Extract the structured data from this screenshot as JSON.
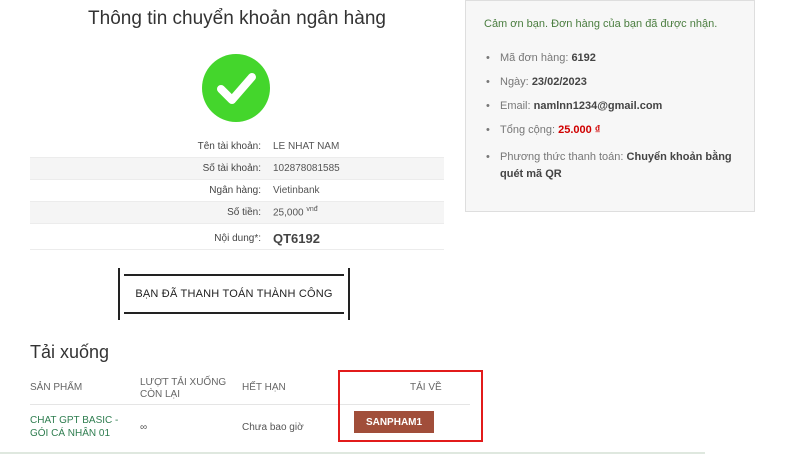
{
  "bank": {
    "title": "Thông tin chuyển khoản ngân hàng",
    "rows": [
      {
        "label": "Tên tài khoản:",
        "value": "LE NHAT NAM"
      },
      {
        "label": "Số tài khoản:",
        "value": "102878081585"
      },
      {
        "label": "Ngân hàng:",
        "value": "Vietinbank"
      },
      {
        "label": "Số tiền:",
        "value": "25,000",
        "unit": "vnđ"
      },
      {
        "label": "Nội dung*:",
        "value": "QT6192"
      }
    ],
    "paid_button": "BẠN ĐÃ THANH TOÁN THÀNH CÔNG"
  },
  "downloads": {
    "title": "Tải xuống",
    "headers": [
      "SẢN PHẨM",
      "LƯỢT TẢI XUỐNG CÒN LẠI",
      "HẾT HẠN",
      "TẢI VỀ"
    ],
    "row": {
      "product": "CHAT GPT BASIC - GÓI CÁ NHÂN 01",
      "remaining": "∞",
      "expires": "Chưa bao giờ",
      "download_label": "SANPHAM1"
    }
  },
  "order": {
    "thank_you": "Cảm ơn bạn. Đơn hàng của bạn đã được nhận.",
    "items": [
      {
        "label": "Mã đơn hàng:",
        "value": "6192"
      },
      {
        "label": "Ngày:",
        "value": "23/02/2023"
      },
      {
        "label": "Email:",
        "value": "namlnn1234@gmail.com"
      },
      {
        "label": "Tổng cộng:",
        "value": "25.000 ₫"
      },
      {
        "label": "Phương thức thanh toán:",
        "value": "Chuyển khoản bằng quét mã QR"
      }
    ]
  },
  "colors": {
    "accent_green": "#44d62c",
    "download_btn": "#a14e3a",
    "highlight": "#e21b1b",
    "total_red": "#d00000"
  }
}
